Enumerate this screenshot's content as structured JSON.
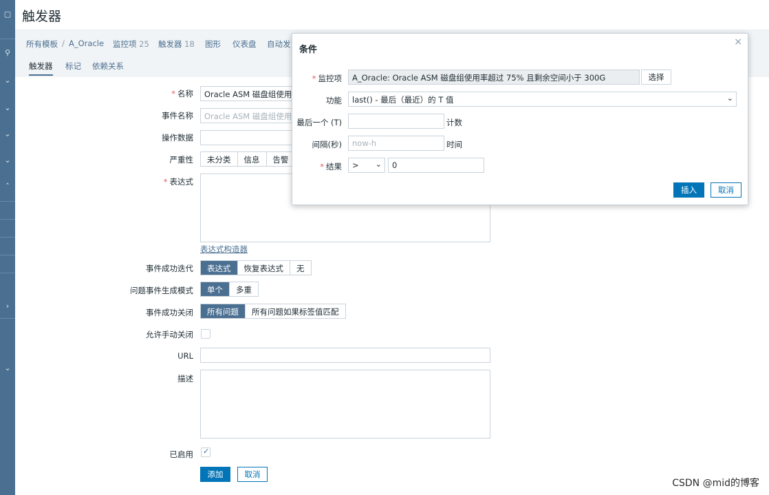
{
  "sidebar": {
    "icons": [
      "menu-icon",
      "search-icon",
      "chevron-icon",
      "chevron-icon",
      "chevron-icon",
      "chevron-icon",
      "chevron-up-icon",
      "chevron-right-icon",
      "chevron-icon"
    ]
  },
  "page": {
    "title": "触发器"
  },
  "breadcrumb": {
    "all_templates": "所有模板",
    "sep": "/",
    "template": "A_Oracle",
    "items_label": "监控项",
    "items_count": "25",
    "triggers_label": "触发器",
    "triggers_count": "18",
    "graphs": "图形",
    "dashboards": "仪表盘",
    "discovery": "自动发"
  },
  "tabs": {
    "trigger": "触发器",
    "tags": "标记",
    "deps": "依赖关系"
  },
  "form": {
    "name_label": "名称",
    "name_value": "Oracle ASM 磁盘组使用率",
    "event_name_label": "事件名称",
    "event_name_value": "Oracle ASM 磁盘组使用率",
    "opdata_label": "操作数据",
    "severity_label": "严重性",
    "severity_options": [
      "未分类",
      "信息",
      "告警"
    ],
    "expression_label": "表达式",
    "expr_builder": "表达式构造器",
    "ok_event_gen_label": "事件成功迭代",
    "ok_event_gen_options": [
      "表达式",
      "恢复表达式",
      "无"
    ],
    "problem_mode_label": "问题事件生成模式",
    "problem_mode_options": [
      "单个",
      "多重"
    ],
    "ok_close_label": "事件成功关闭",
    "ok_close_options": [
      "所有问题",
      "所有问题如果标签值匹配"
    ],
    "manual_close_label": "允许手动关闭",
    "url_label": "URL",
    "desc_label": "描述",
    "enabled_label": "已启用",
    "add_button": "添加",
    "cancel_button": "取消"
  },
  "dialog": {
    "title": "条件",
    "close": "×",
    "item_label": "监控项",
    "item_value": "A_Oracle: Oracle ASM 磁盘组使用率超过 75% 且剩余空间小于 300G",
    "select_button": "选择",
    "function_label": "功能",
    "function_value": "last() - 最后（最近）的 T 值",
    "last_of_label": "最后一个 (T)",
    "last_of_value": "",
    "count_label": "计数",
    "shift_label": "间隔(秒)",
    "shift_placeholder": "now-h",
    "time_label": "时间",
    "result_label": "结果",
    "result_operator": ">",
    "result_value": "0",
    "insert_button": "插入",
    "cancel_button": "取消"
  },
  "watermark": "CSDN @mid的博客",
  "colors": {
    "sidebar": "#4a6f91",
    "primary": "#0275b8",
    "segment_active": "#4a6f91",
    "required": "#e45959"
  }
}
